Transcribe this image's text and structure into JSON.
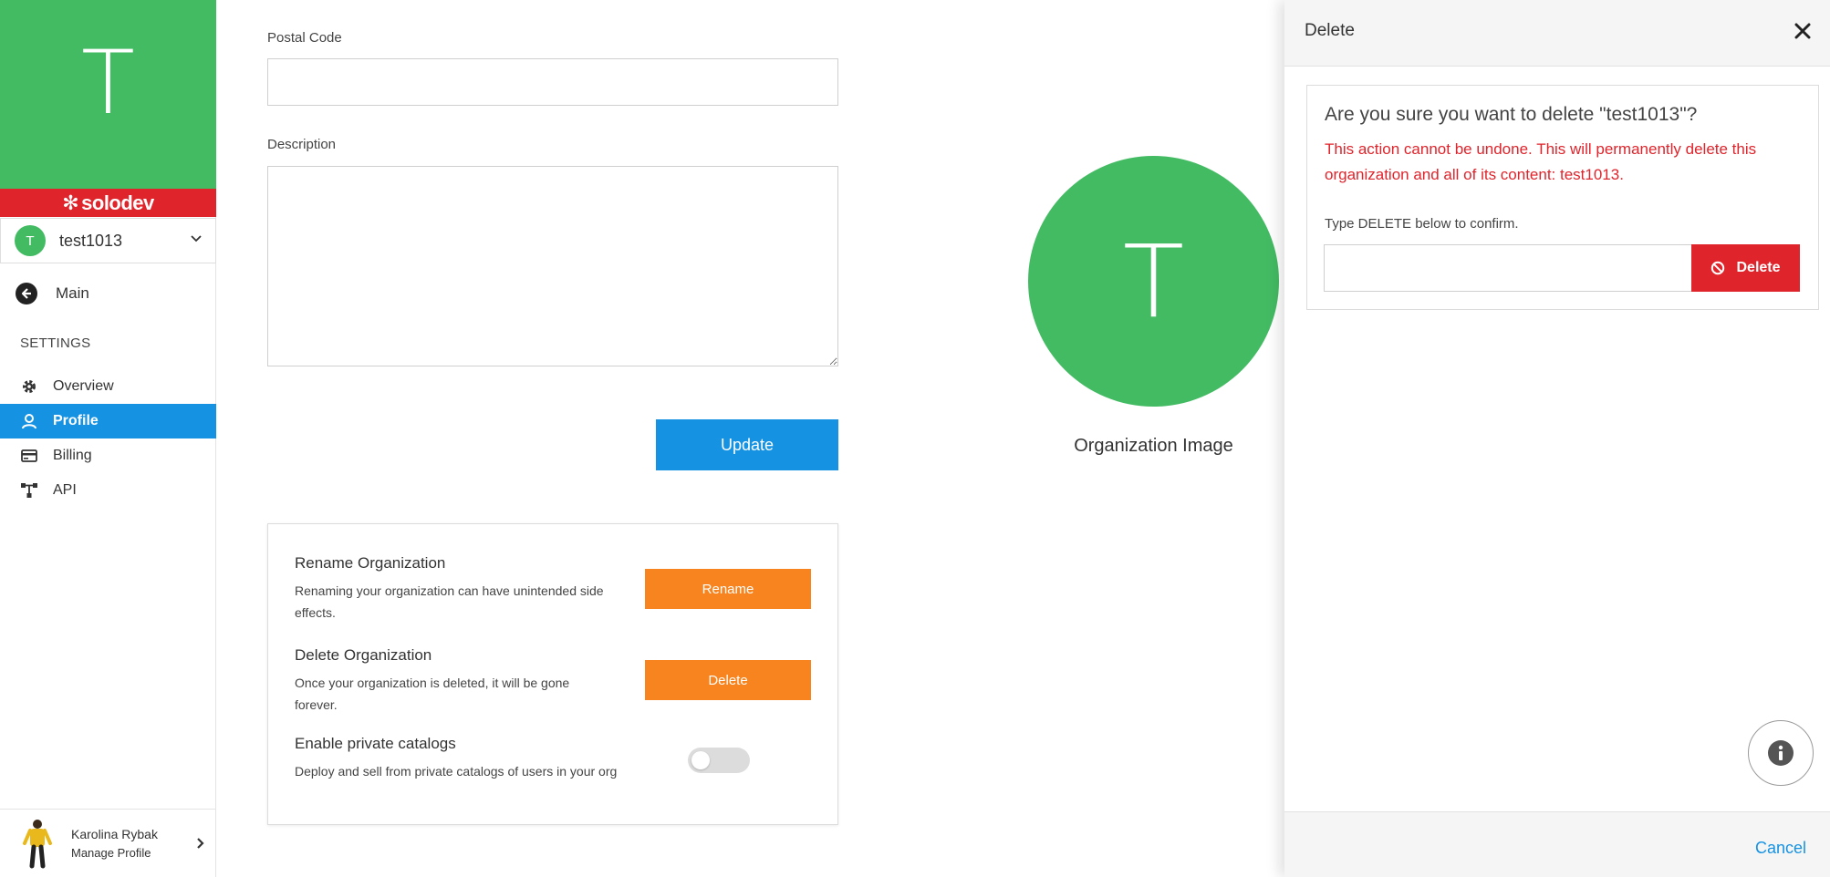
{
  "sidebar": {
    "org_initial": "T",
    "brand": "solodev",
    "org_selector": {
      "avatar_initial": "T",
      "name": "test1013"
    },
    "main_link": "Main",
    "settings_heading": "SETTINGS",
    "items": [
      {
        "label": "Overview",
        "icon": "gear-icon"
      },
      {
        "label": "Profile",
        "icon": "user-icon",
        "active": true
      },
      {
        "label": "Billing",
        "icon": "credit-card-icon"
      },
      {
        "label": "API",
        "icon": "sitemap-icon"
      }
    ],
    "user": {
      "name": "Karolina Rybak",
      "action": "Manage Profile"
    }
  },
  "form": {
    "postal_code_label": "Postal Code",
    "postal_code_value": "",
    "description_label": "Description",
    "description_value": "",
    "update_button": "Update"
  },
  "danger_zone": {
    "rename": {
      "title": "Rename Organization",
      "desc": "Renaming your organization can have unintended side effects.",
      "button": "Rename"
    },
    "delete": {
      "title": "Delete Organization",
      "desc": "Once your organization is deleted, it will be gone forever.",
      "button": "Delete"
    },
    "private_catalogs": {
      "title": "Enable private catalogs",
      "desc": "Deploy and sell from private catalogs of users in your org",
      "enabled": false
    }
  },
  "org_image": {
    "initial": "T",
    "caption": "Organization Image"
  },
  "drawer": {
    "title": "Delete",
    "question": "Are you sure you want to delete \"test1013\"?",
    "warning": "This action cannot be undone. This will permanently delete this organization and all of its content: test1013.",
    "hint": "Type DELETE below to confirm.",
    "input_value": "",
    "delete_button": "Delete",
    "cancel": "Cancel"
  },
  "colors": {
    "org_green": "#43bb63",
    "brand_red": "#e0242b",
    "primary_blue": "#1692e3",
    "orange": "#f7841e"
  }
}
